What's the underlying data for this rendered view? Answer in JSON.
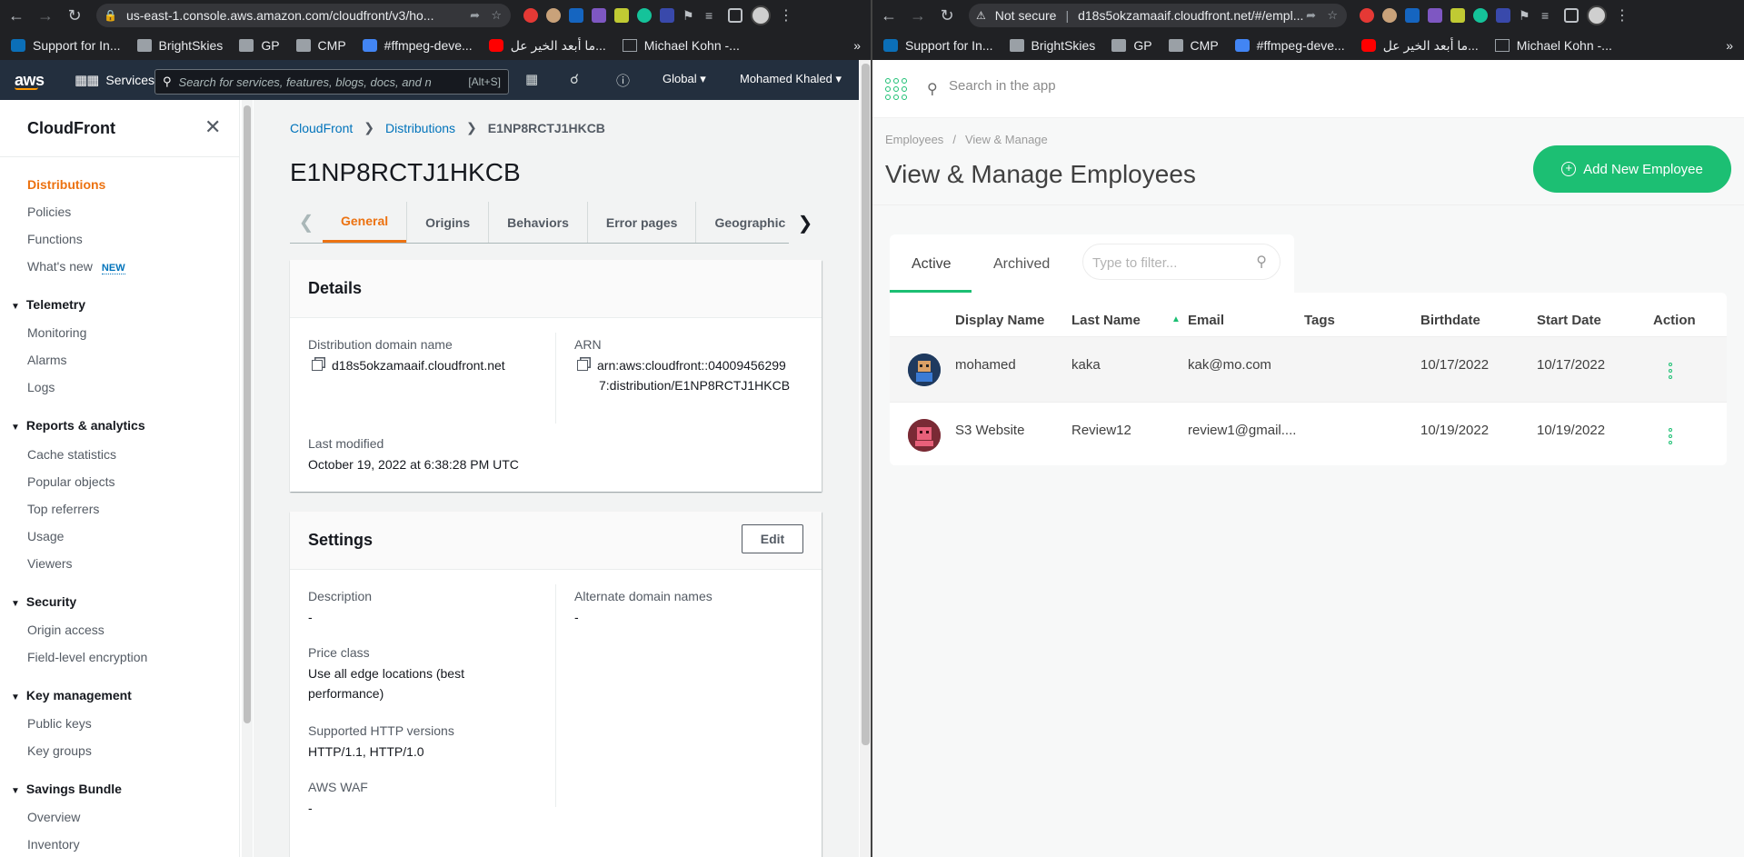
{
  "left_browser": {
    "url": "us-east-1.console.aws.amazon.com/cloudfront/v3/ho...",
    "bookmarks": [
      {
        "label": "Support for In..."
      },
      {
        "label": "BrightSkies"
      },
      {
        "label": "GP"
      },
      {
        "label": "CMP"
      },
      {
        "label": "#ffmpeg-deve..."
      },
      {
        "label": "ما أبعد الخير عل..."
      },
      {
        "label": "Michael Kohn -..."
      }
    ],
    "bookmarks_more": "»"
  },
  "right_browser": {
    "not_secure": "Not secure",
    "url": "d18s5okzamaaif.cloudfront.net/#/empl...",
    "bookmarks": [
      {
        "label": "Support for In..."
      },
      {
        "label": "BrightSkies"
      },
      {
        "label": "GP"
      },
      {
        "label": "CMP"
      },
      {
        "label": "#ffmpeg-deve..."
      },
      {
        "label": "ما أبعد الخير عل..."
      },
      {
        "label": "Michael Kohn -..."
      }
    ],
    "bookmarks_more": "»"
  },
  "aws": {
    "logo": "aws",
    "services_label": "Services",
    "search_placeholder": "Search for services, features, blogs, docs, and n",
    "search_shortcut": "[Alt+S]",
    "region": "Global",
    "account": "Mohamed Khaled",
    "sidebar": {
      "title": "CloudFront",
      "items": [
        {
          "label": "Distributions"
        },
        {
          "label": "Policies"
        },
        {
          "label": "Functions"
        },
        {
          "label": "What's new",
          "badge": "NEW"
        }
      ],
      "sections": [
        {
          "title": "Telemetry",
          "items": [
            "Monitoring",
            "Alarms",
            "Logs"
          ]
        },
        {
          "title": "Reports & analytics",
          "items": [
            "Cache statistics",
            "Popular objects",
            "Top referrers",
            "Usage",
            "Viewers"
          ]
        },
        {
          "title": "Security",
          "items": [
            "Origin access",
            "Field-level encryption"
          ]
        },
        {
          "title": "Key management",
          "items": [
            "Public keys",
            "Key groups"
          ]
        },
        {
          "title": "Savings Bundle",
          "items": [
            "Overview",
            "Inventory"
          ]
        }
      ]
    },
    "breadcrumb": {
      "root": "CloudFront",
      "mid": "Distributions",
      "current": "E1NP8RCTJ1HKCB"
    },
    "page_title": "E1NP8RCTJ1HKCB",
    "tabs": [
      "General",
      "Origins",
      "Behaviors",
      "Error pages",
      "Geographic r"
    ],
    "details": {
      "title": "Details",
      "domain_label": "Distribution domain name",
      "domain_value": "d18s5okzamaaif.cloudfront.net",
      "arn_label": "ARN",
      "arn_line1": "arn:aws:cloudfront::04009456299",
      "arn_line2": "7:distribution/E1NP8RCTJ1HKCB",
      "modified_label": "Last modified",
      "modified_value": "October 19, 2022 at 6:38:28 PM UTC"
    },
    "settings": {
      "title": "Settings",
      "edit_label": "Edit",
      "description_label": "Description",
      "description_value": "-",
      "alt_domains_label": "Alternate domain names",
      "alt_domains_value": "-",
      "price_label": "Price class",
      "price_line1": "Use all edge locations (best",
      "price_line2": "performance)",
      "http_label": "Supported HTTP versions",
      "http_value": "HTTP/1.1, HTTP/1.0",
      "waf_label": "AWS WAF",
      "waf_value": "-"
    }
  },
  "app": {
    "search_placeholder": "Search in the app",
    "breadcrumb": {
      "root": "Employees",
      "sep": "/",
      "current": "View & Manage"
    },
    "title": "View & Manage Employees",
    "add_button": "Add New Employee",
    "tabs": {
      "active": "Active",
      "archived": "Archived"
    },
    "filter_placeholder": "Type to filter...",
    "columns": [
      "Display Name",
      "Last Name",
      "Email",
      "Tags",
      "Birthdate",
      "Start Date",
      "Action"
    ],
    "rows": [
      {
        "display_name": "mohamed",
        "last_name": "kaka",
        "email": "kak@mo.com",
        "tags": "",
        "birthdate": "10/17/2022",
        "start_date": "10/17/2022"
      },
      {
        "display_name": "S3 Website",
        "last_name": "Review12",
        "email": "review1@gmail....",
        "tags": "",
        "birthdate": "10/19/2022",
        "start_date": "10/19/2022"
      }
    ],
    "accent": "#1cbf73"
  }
}
